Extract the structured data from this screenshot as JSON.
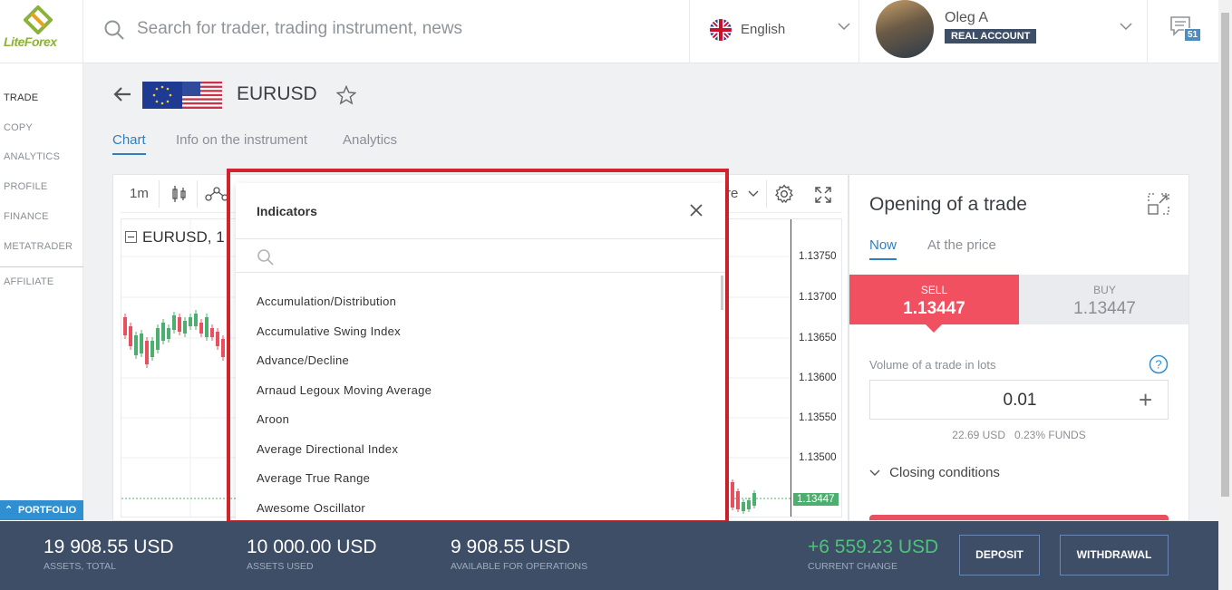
{
  "logo": {
    "brand": "LiteForex"
  },
  "search": {
    "placeholder": "Search for trader, trading instrument, news",
    "icon": "search-icon"
  },
  "language": {
    "label": "English"
  },
  "user": {
    "name": "Oleg A",
    "account_type": "REAL ACCOUNT"
  },
  "messages": {
    "count": "51"
  },
  "sidebar": {
    "items": [
      {
        "label": "TRADE"
      },
      {
        "label": "COPY"
      },
      {
        "label": "ANALYTICS"
      },
      {
        "label": "PROFILE"
      },
      {
        "label": "FINANCE"
      },
      {
        "label": "METATRADER"
      },
      {
        "label": "AFFILIATE"
      }
    ],
    "portfolio_label": "PORTFOLIO"
  },
  "instrument": {
    "symbol": "EURUSD",
    "tabs": [
      {
        "label": "Chart"
      },
      {
        "label": "Info on the instrument"
      },
      {
        "label": "Analytics"
      }
    ]
  },
  "chart": {
    "timeframe": "1m",
    "legend": "EURUSD, 1",
    "toolbar_partial": "re",
    "price_ticks": [
      "1.13750",
      "1.13700",
      "1.13650",
      "1.13600",
      "1.13550",
      "1.13500"
    ],
    "last_price": "1.13447",
    "colors": {
      "up": "#4caf6e",
      "down": "#e8505f"
    }
  },
  "indicators": {
    "title": "Indicators",
    "search_placeholder": "",
    "items": [
      "Accumulation/Distribution",
      "Accumulative Swing Index",
      "Advance/Decline",
      "Arnaud Legoux Moving Average",
      "Aroon",
      "Average Directional Index",
      "Average True Range",
      "Awesome Oscillator"
    ]
  },
  "trade": {
    "title": "Opening of a trade",
    "tabs": [
      {
        "label": "Now"
      },
      {
        "label": "At the price"
      }
    ],
    "sell": {
      "label": "SELL",
      "price": "1.13447"
    },
    "buy": {
      "label": "BUY",
      "price": "1.13447"
    },
    "volume_label": "Volume of a trade in lots",
    "volume_value": "0.01",
    "volume_usd": "22.69 USD",
    "volume_funds": "0.23% FUNDS",
    "closing_label": "Closing conditions"
  },
  "footer": {
    "assets_total": {
      "value": "19 908.55 USD",
      "label": "ASSETS, TOTAL"
    },
    "assets_used": {
      "value": "10 000.00 USD",
      "label": "ASSETS USED"
    },
    "available": {
      "value": "9 908.55 USD",
      "label": "AVAILABLE FOR OPERATIONS"
    },
    "change": {
      "value": "+6 559.23 USD",
      "label": "CURRENT CHANGE"
    },
    "deposit_label": "DEPOSIT",
    "withdrawal_label": "WITHDRAWAL"
  },
  "accent_colors": {
    "brand_green": "#8bb33b",
    "brand_orange": "#e4a423",
    "highlight_red": "#d0252d",
    "link_blue": "#2f7fc0"
  }
}
